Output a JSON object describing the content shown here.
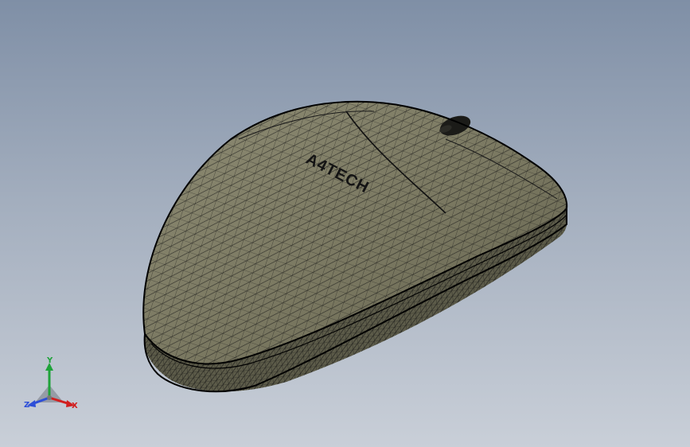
{
  "model": {
    "logo_text": "A4TECH",
    "body_color": "#7c7a64",
    "mesh_color": "#101010",
    "edge_color": "#000000"
  },
  "triad": {
    "y_label": "Y",
    "x_label": "X",
    "z_label": "Z",
    "y_color": "#1fa33a",
    "x_color": "#d11f1f",
    "z_color": "#2d4fd8"
  }
}
